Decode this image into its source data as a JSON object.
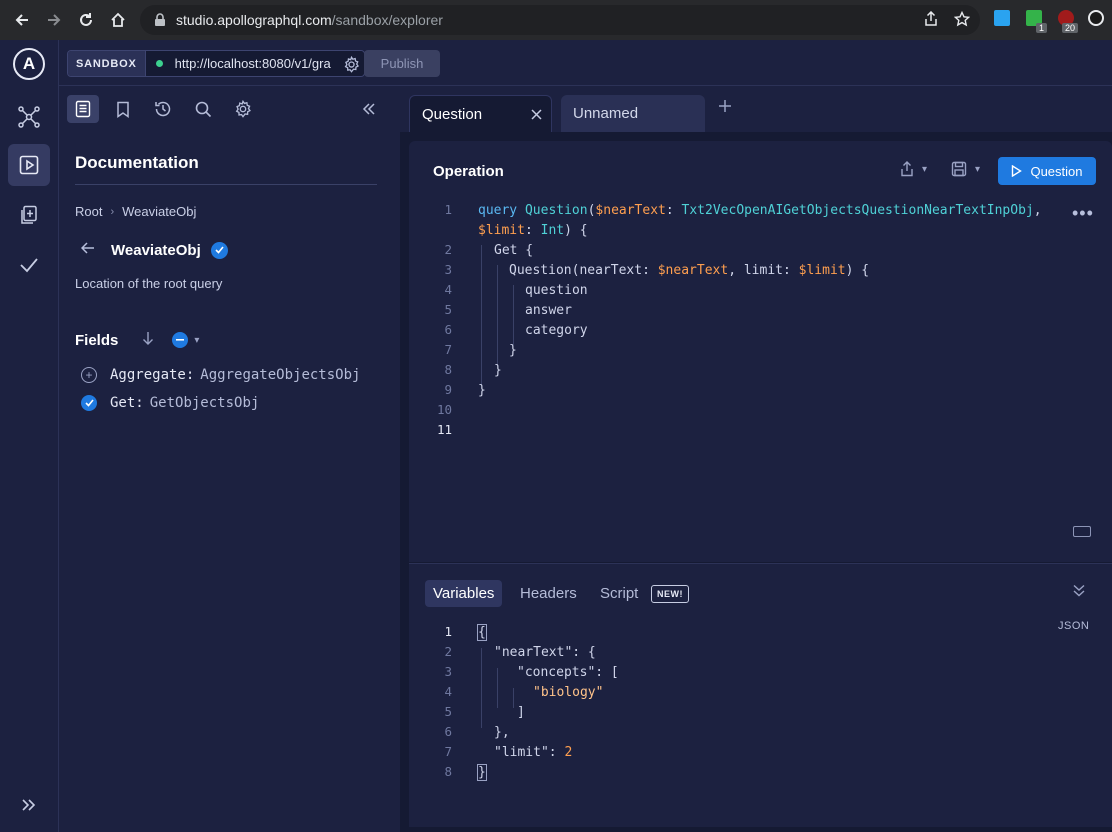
{
  "browser": {
    "url_host": "studio.apollographql.com",
    "url_path": "/sandbox/explorer",
    "ext_badge_1": "1",
    "ext_badge_2": "20"
  },
  "rail": {
    "logo": "A",
    "items": [
      "schema-icon",
      "explorer-icon",
      "checks-icon",
      "check-icon"
    ],
    "expand_icon": "double-chevron-right-icon"
  },
  "appbar": {
    "sandbox_label": "SANDBOX",
    "endpoint": "http://localhost:8080/v1/gra",
    "publish_label": "Publish"
  },
  "docs": {
    "title": "Documentation",
    "breadcrumb": [
      "Root",
      "WeaviateObj"
    ],
    "type_name": "WeaviateObj",
    "type_description": "Location of the root query",
    "fields_label": "Fields",
    "fields": [
      {
        "name": "Aggregate",
        "type": "AggregateObjectsObj",
        "selected": false
      },
      {
        "name": "Get",
        "type": "GetObjectsObj",
        "selected": true
      }
    ]
  },
  "tabs": [
    {
      "label": "Question",
      "active": true
    },
    {
      "label": "Unnamed",
      "active": false
    }
  ],
  "operation": {
    "title": "Operation",
    "run_label": "Question",
    "line_numbers": [
      "1",
      "",
      "2",
      "3",
      "4",
      "5",
      "6",
      "7",
      "8",
      "9",
      "10",
      "11"
    ],
    "code": {
      "l1_kw": "query",
      "l1_name": "Question",
      "l1_var1": "$nearText",
      "l1_type1": "Txt2VecOpenAIGetObjectsQuestionNearTextInpObj",
      "l1b_var2": "$limit",
      "l1b_type2": "Int",
      "l2": "Get {",
      "l3_field": "Question",
      "l3_arg1": "nearText",
      "l3_var1": "$nearText",
      "l3_arg2": "limit",
      "l3_var2": "$limit",
      "l4": "question",
      "l5": "answer",
      "l6": "category",
      "l7": "}",
      "l8": "}",
      "l9": "}"
    }
  },
  "variables": {
    "tabs": [
      "Variables",
      "Headers",
      "Script"
    ],
    "new_badge": "NEW!",
    "format_label": "JSON",
    "line_numbers": [
      "1",
      "2",
      "3",
      "4",
      "5",
      "6",
      "7",
      "8"
    ],
    "json": {
      "l1": "{",
      "l2_key": "\"nearText\"",
      "l3_key": "\"concepts\"",
      "l4_str": "\"biology\"",
      "l5": "]",
      "l6": "},",
      "l7_key": "\"limit\"",
      "l7_val": "2",
      "l8": "}"
    }
  }
}
